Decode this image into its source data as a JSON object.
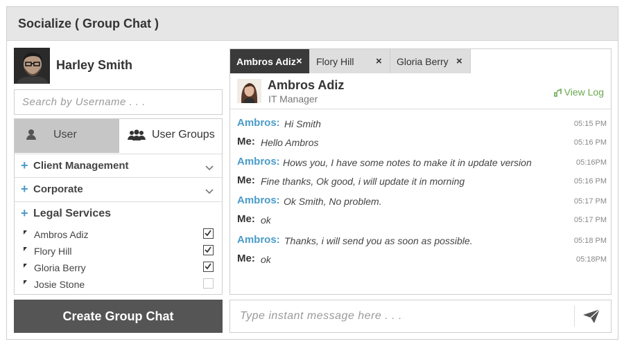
{
  "app": {
    "title": "Socialize ( Group Chat )"
  },
  "user": {
    "name": "Harley Smith"
  },
  "search": {
    "placeholder": "Search by Username . . ."
  },
  "tabs": {
    "user_label": "User",
    "groups_label": "User Groups"
  },
  "groups": [
    {
      "label": "Client Management"
    },
    {
      "label": "Corporate"
    },
    {
      "label": "Legal Services"
    }
  ],
  "members": [
    {
      "name": "Ambros Adiz",
      "checked": true
    },
    {
      "name": "Flory Hill",
      "checked": true
    },
    {
      "name": "Gloria Berry",
      "checked": true
    },
    {
      "name": "Josie Stone",
      "checked": false
    }
  ],
  "create_button": "Create Group Chat",
  "chat_tabs": [
    {
      "label": "Ambros Adiz",
      "active": true
    },
    {
      "label": "Flory Hill",
      "active": false
    },
    {
      "label": "Gloria Berry",
      "active": false
    }
  ],
  "close_symbol": "×",
  "contact": {
    "name": "Ambros Adiz",
    "role": "IT Manager",
    "view_log": "View Log"
  },
  "messages": [
    {
      "from": "Ambros:",
      "text": "Hi Smith",
      "time": "05:15 PM"
    },
    {
      "from": "Me:",
      "text": "Hello Ambros",
      "time": "05:16 PM"
    },
    {
      "from": "Ambros:",
      "text": "Hows you, I have some notes to make it in update version",
      "time": "05:16PM"
    },
    {
      "from": "Me:",
      "text": "Fine thanks, Ok good, i will update it in morning",
      "time": "05:16 PM"
    },
    {
      "from": "Ambros:",
      "text": "Ok Smith, No problem.",
      "time": "05:17 PM"
    },
    {
      "from": "Me:",
      "text": "ok",
      "time": "05:17 PM"
    },
    {
      "from": "Ambros:",
      "text": "Thanks, i will send you as soon as possible.",
      "time": "05:18 PM"
    },
    {
      "from": "Me:",
      "text": "ok",
      "time": "05:18PM"
    }
  ],
  "compose": {
    "placeholder": "Type instant message here . . ."
  },
  "colors": {
    "accent": "#4a9bc8",
    "dark": "#3a3a3a",
    "button": "#555555",
    "log": "#6aa84f"
  }
}
